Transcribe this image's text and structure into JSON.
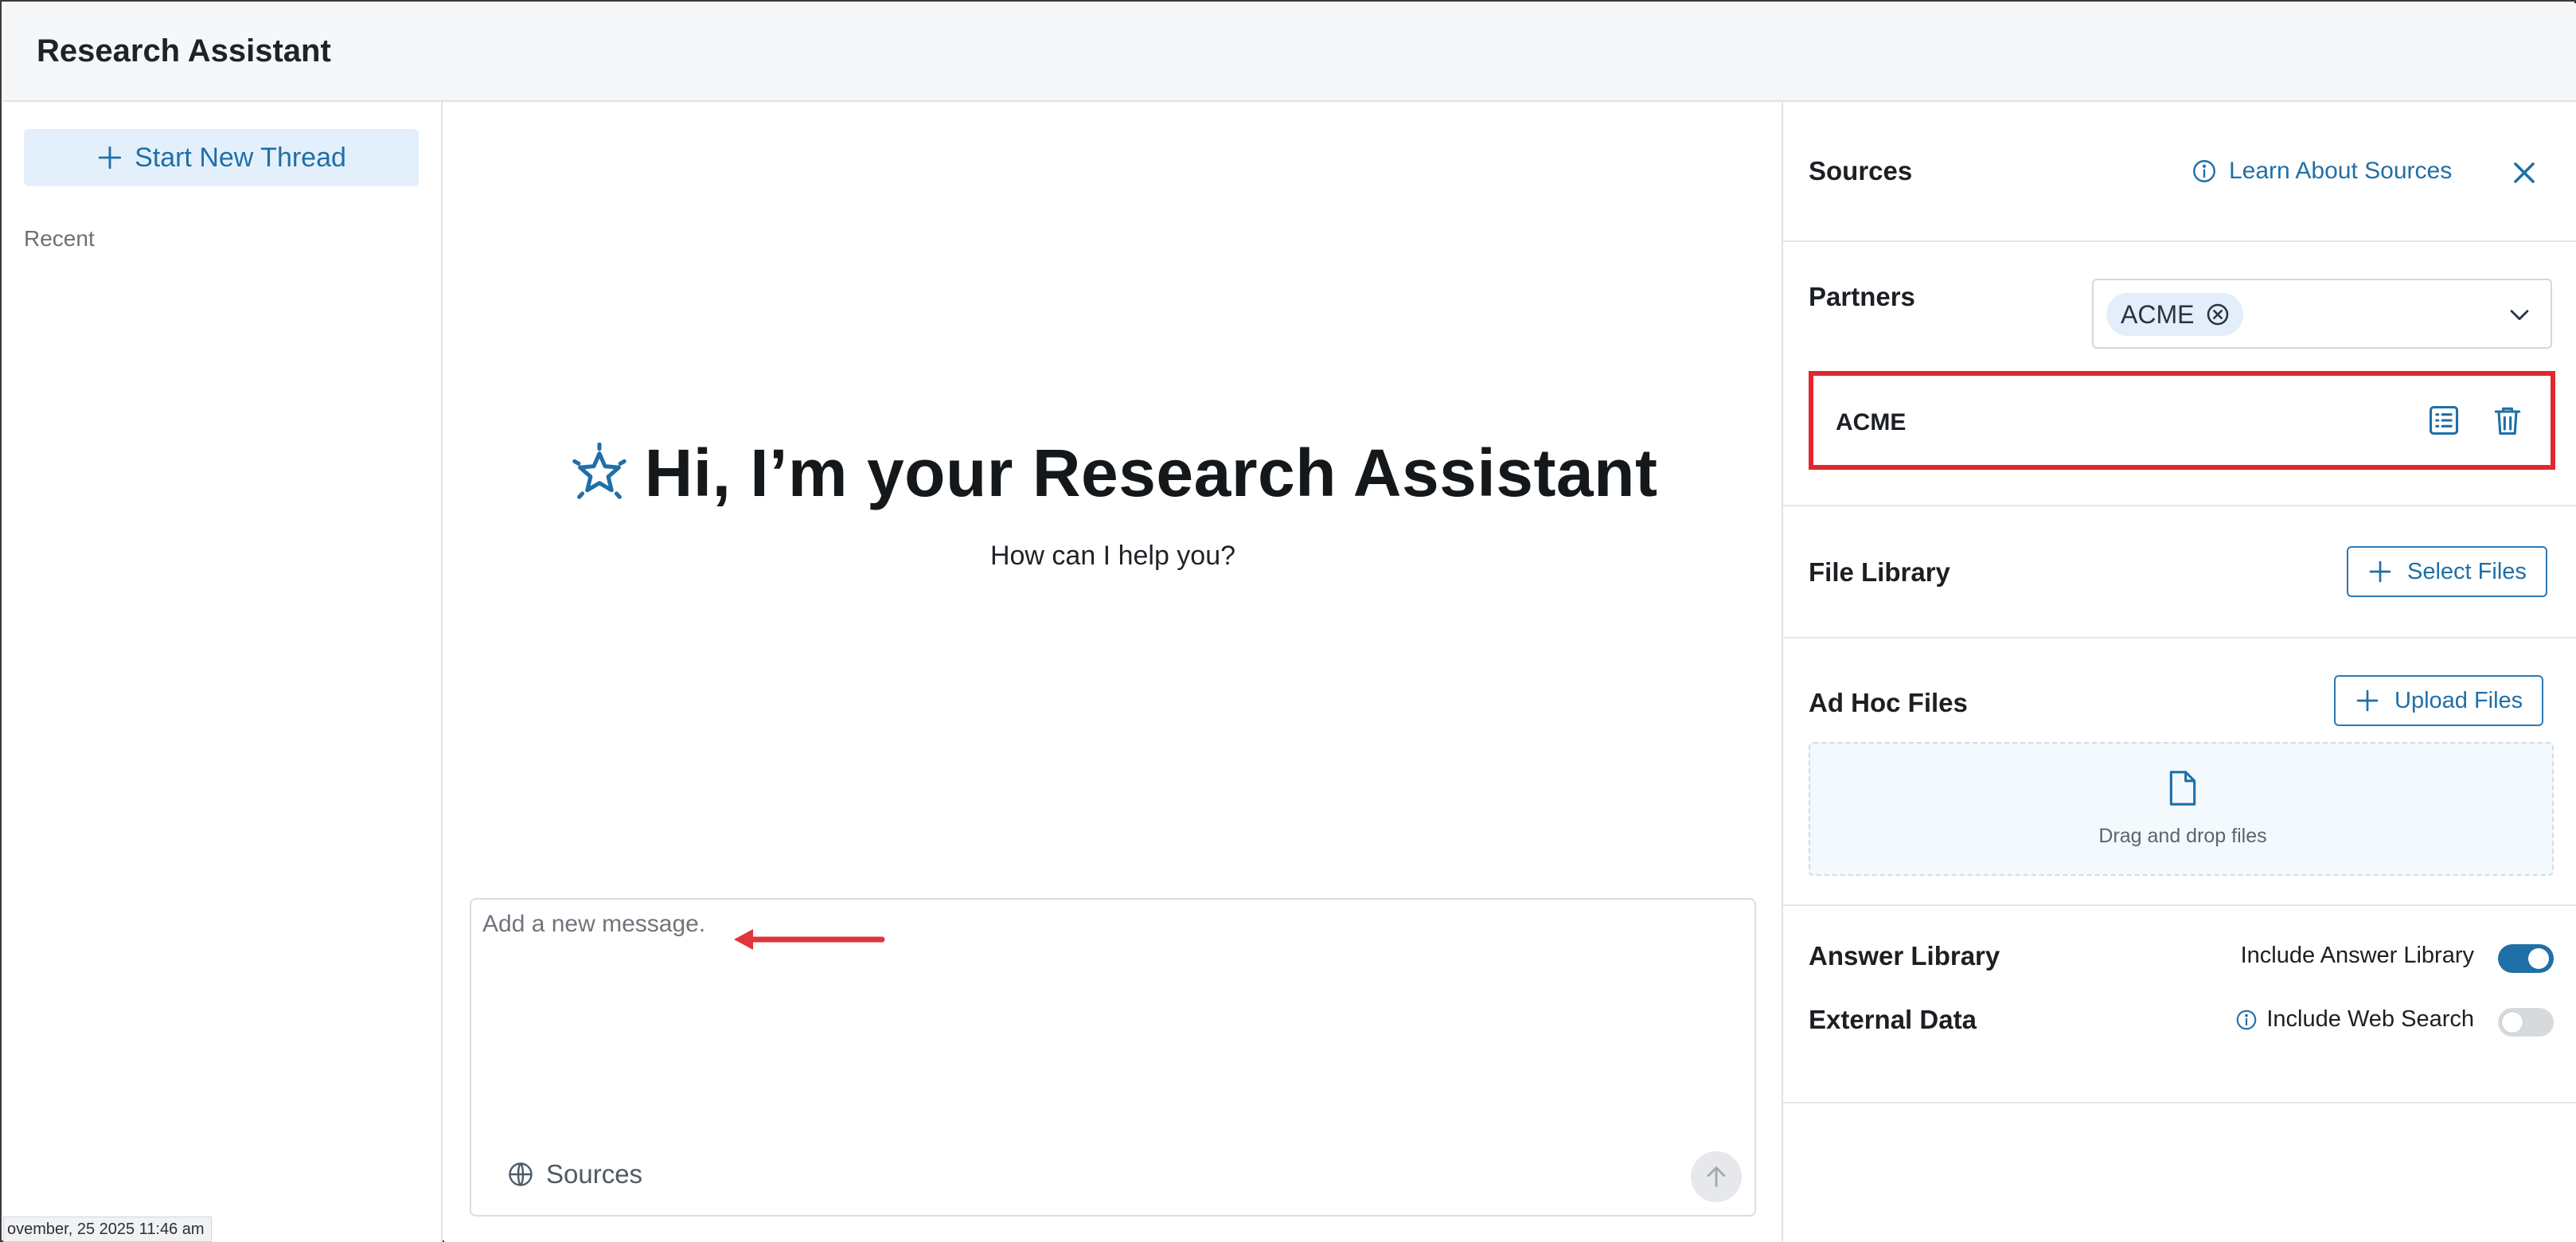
{
  "app": {
    "title": "Research Assistant"
  },
  "sidebar": {
    "new_thread_label": "Start New Thread",
    "recent_label": "Recent",
    "timestamp": "ovember, 25 2025 11:46 am"
  },
  "main": {
    "greeting": "Hi, I’m your Research Assistant",
    "subtitle": "How can I help you?",
    "composer": {
      "placeholder": "Add a new message.",
      "value": "",
      "sources_label": "Sources"
    }
  },
  "sources_panel": {
    "title": "Sources",
    "learn_label": "Learn About Sources",
    "partners": {
      "title": "Partners",
      "selected_chips": [
        "ACME"
      ],
      "rows": [
        {
          "name": "ACME"
        }
      ]
    },
    "file_library": {
      "title": "File Library",
      "button_label": "Select Files"
    },
    "adhoc_files": {
      "title": "Ad Hoc Files",
      "button_label": "Upload Files",
      "drop_text": "Drag and drop files"
    },
    "answer_library": {
      "title": "Answer Library",
      "toggle_label": "Include Answer Library",
      "enabled": true
    },
    "external_data": {
      "title": "External Data",
      "toggle_label": "Include Web Search",
      "enabled": false
    }
  },
  "colors": {
    "accent": "#1f6fa8",
    "highlight_border": "#e0282e",
    "annotation_arrow": "#e0353b"
  },
  "icons": {
    "new_thread": "plus-icon",
    "greeting": "sparkle-star-icon",
    "composer_sources": "globe-icon",
    "send": "arrow-up-icon",
    "learn": "info-circle-icon",
    "close": "close-icon",
    "chip_remove": "circle-x-icon",
    "dropdown": "chevron-down-icon",
    "details": "list-details-icon",
    "delete": "trash-icon",
    "drop": "file-icon"
  }
}
